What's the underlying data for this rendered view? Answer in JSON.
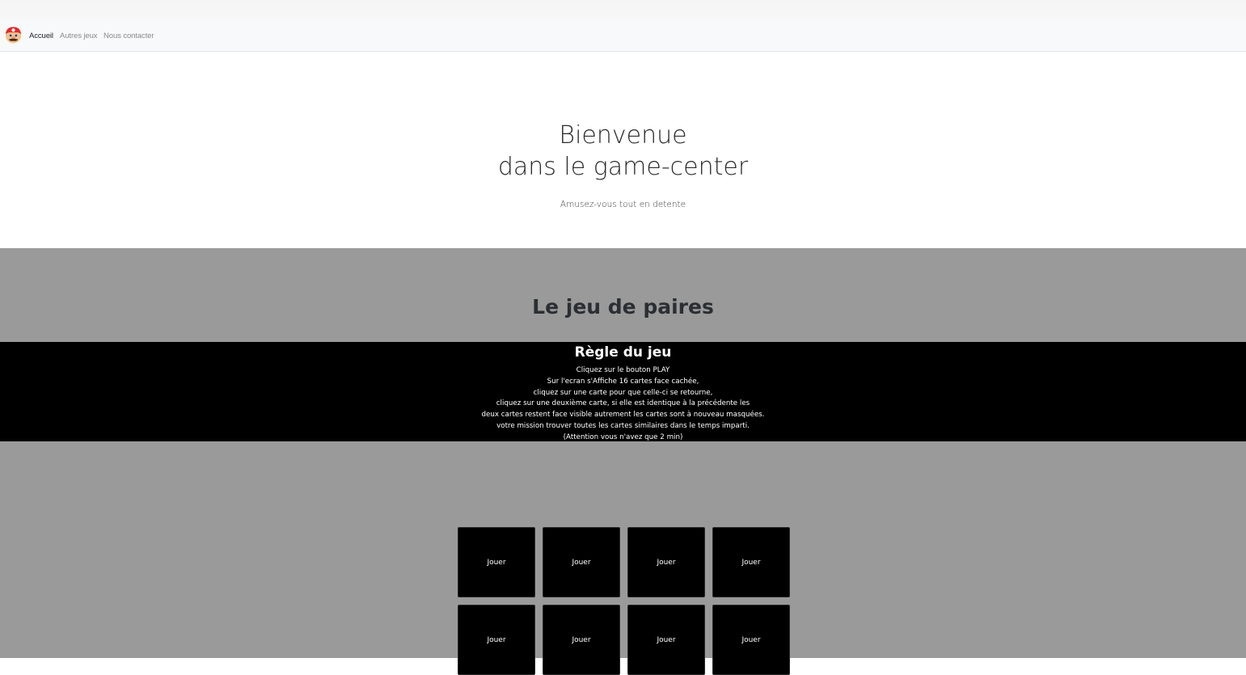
{
  "nav": {
    "logo_icon": "mario-face-icon",
    "items": [
      {
        "label": "Accueil",
        "active": true
      },
      {
        "label": "Autres jeux",
        "active": false
      },
      {
        "label": "Nous contacter",
        "active": false
      }
    ]
  },
  "hero": {
    "title_line1": "Bienvenue",
    "title_line2": "dans le game-center",
    "subtitle": "Amusez-vous tout en detente"
  },
  "game": {
    "title": "Le jeu de paires",
    "rules": {
      "title": "Règle du jeu",
      "lines": [
        "Cliquez sur le bouton PLAY",
        "Sur l'ecran s'Affiche 16 cartes face cachée,",
        "cliquez sur une carte pour que celle-ci se retourne,",
        "cliquez sur une deuxième carte, si elle est identique à la précédente les",
        "deux cartes restent face visible autrement les cartes sont à nouveau masquées.",
        "votre mission trouver toutes les cartes similaires dans le temps imparti.",
        "(Attention vous n'avez que 2 min)"
      ]
    },
    "cards": [
      {
        "label": "Jouer"
      },
      {
        "label": "Jouer"
      },
      {
        "label": "Jouer"
      },
      {
        "label": "Jouer"
      },
      {
        "label": "Jouer"
      },
      {
        "label": "Jouer"
      },
      {
        "label": "Jouer"
      },
      {
        "label": "Jouer"
      }
    ]
  },
  "colors": {
    "section_bg": "#9a9a9a",
    "rules_bg": "#000000",
    "card_bg": "#000000"
  }
}
